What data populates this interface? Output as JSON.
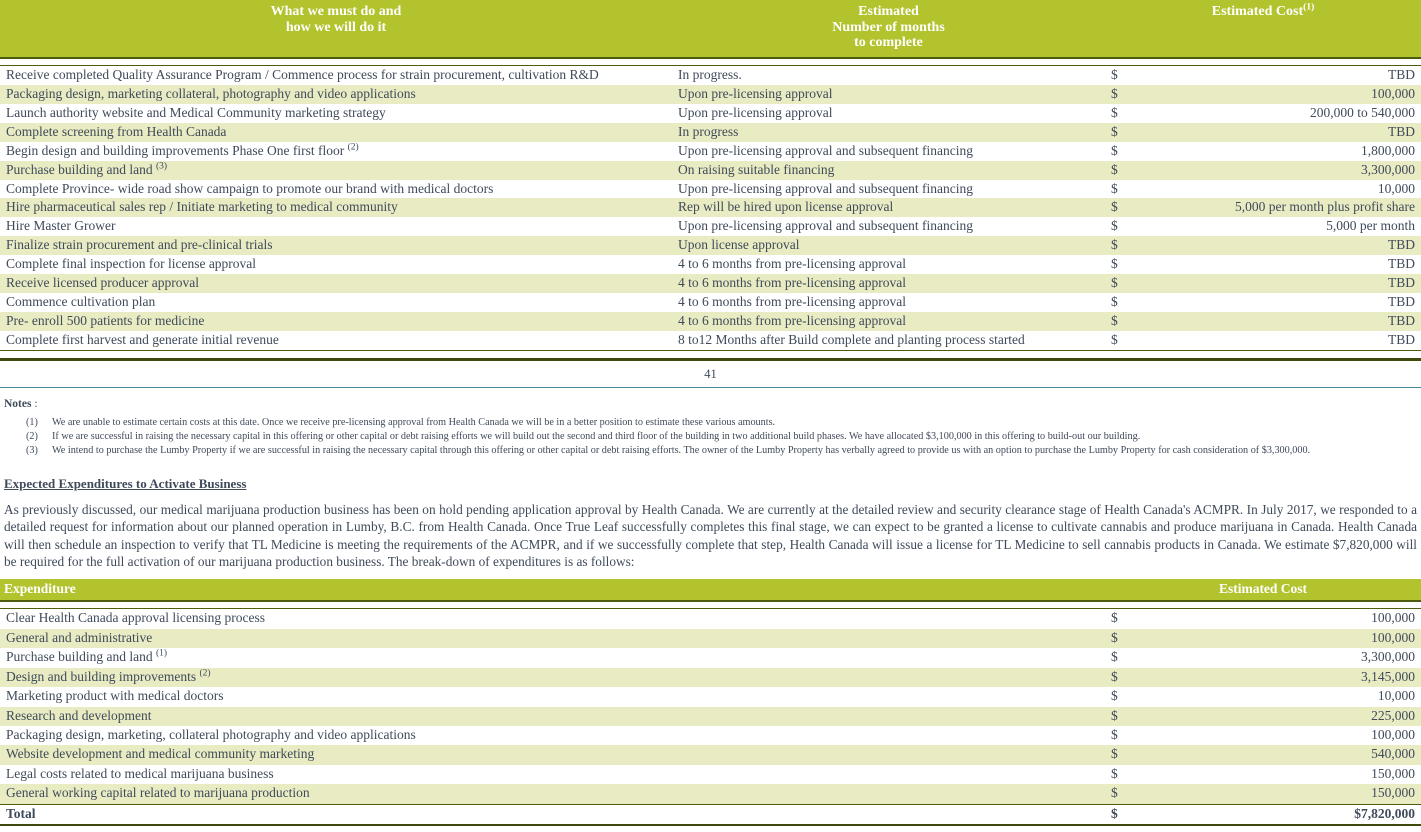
{
  "milestones_table": {
    "headers": {
      "task": "What we must do and\nhow we will do it",
      "task_line1": "What we must do and",
      "task_line2": "how we will do it",
      "months_line1": "Estimated",
      "months_line2": "Number of months",
      "months_line3": "to complete",
      "cost": "Estimated Cost",
      "cost_footnote": "(1)"
    },
    "rows": [
      {
        "task": "Receive completed Quality Assurance Program / Commence process for strain procurement, cultivation R&D",
        "task_sup": "",
        "when": "In progress.",
        "dollar": "$",
        "cost": "TBD"
      },
      {
        "task": "Packaging design, marketing collateral, photography and video applications",
        "task_sup": "",
        "when": "Upon pre-licensing approval",
        "dollar": "$",
        "cost": "100,000"
      },
      {
        "task": "Launch authority website and Medical Community marketing strategy",
        "task_sup": "",
        "when": "Upon pre-licensing approval",
        "dollar": "$",
        "cost": "200,000 to 540,000"
      },
      {
        "task": "Complete screening from Health Canada",
        "task_sup": "",
        "when": "In progress",
        "dollar": "$",
        "cost": "TBD"
      },
      {
        "task": "Begin design and building improvements Phase One first floor",
        "task_sup": "(2)",
        "when": "Upon pre-licensing approval and subsequent financing",
        "dollar": "$",
        "cost": "1,800,000"
      },
      {
        "task": "Purchase building and land",
        "task_sup": "(3)",
        "when": "On raising suitable financing",
        "dollar": "$",
        "cost": "3,300,000"
      },
      {
        "task": "Complete Province- wide road show campaign to promote our brand with medical doctors",
        "task_sup": "",
        "when": "Upon pre-licensing approval and subsequent financing",
        "dollar": "$",
        "cost": "10,000"
      },
      {
        "task": "Hire pharmaceutical sales rep / Initiate marketing to medical community",
        "task_sup": "",
        "when": "Rep will be hired upon license approval",
        "dollar": "$",
        "cost": "5,000 per month plus profit share"
      },
      {
        "task": "Hire Master Grower",
        "task_sup": "",
        "when": "Upon pre-licensing approval and subsequent financing",
        "dollar": "$",
        "cost": "5,000 per month"
      },
      {
        "task": "Finalize strain procurement and pre-clinical trials",
        "task_sup": "",
        "when": "Upon license approval",
        "dollar": "$",
        "cost": "TBD"
      },
      {
        "task": "Complete final inspection for license approval",
        "task_sup": "",
        "when": "4 to 6 months from pre-licensing approval",
        "dollar": "$",
        "cost": "TBD"
      },
      {
        "task": "Receive licensed producer approval",
        "task_sup": "",
        "when": "4 to 6 months from pre-licensing approval",
        "dollar": "$",
        "cost": "TBD"
      },
      {
        "task": "Commence cultivation plan",
        "task_sup": "",
        "when": "4 to 6 months from pre-licensing approval",
        "dollar": "$",
        "cost": "TBD"
      },
      {
        "task": "Pre- enroll 500 patients for medicine",
        "task_sup": "",
        "when": "4 to 6 months from pre-licensing approval",
        "dollar": "$",
        "cost": "TBD"
      },
      {
        "task": "Complete first harvest and generate initial revenue",
        "task_sup": "",
        "when": "8 to12 Months after Build complete and planting process started",
        "dollar": "$",
        "cost": "TBD"
      }
    ]
  },
  "page_number": "41",
  "notes": {
    "title": "Notes",
    "title_colon": " :",
    "items": [
      {
        "marker": "(1)",
        "text": "We are unable to estimate certain costs at this date. Once we receive pre-licensing approval from Health Canada we will be in a better position to estimate these various amounts."
      },
      {
        "marker": "(2)",
        "text": "If we are successful in raising the necessary capital in this offering or other capital or debt raising efforts we will build out the second and third floor of the building in two additional build phases. We have allocated $3,100,000 in this offering to build-out our building."
      },
      {
        "marker": "(3)",
        "text": "We intend to purchase the Lumby Property if we are successful in raising the necessary capital through this offering or other capital or debt raising efforts. The owner of the Lumby Property has verbally agreed to provide us with an option to purchase the Lumby Property for cash consideration of $3,300,000."
      }
    ]
  },
  "section": {
    "heading": "Expected Expenditures to Activate Business",
    "paragraph": "As previously discussed, our medical marijuana production business has been on hold pending application approval by Health Canada. We are currently at the detailed review and security clearance stage of Health Canada's ACMPR. In July 2017, we responded to a detailed request for information about our planned operation in Lumby, B.C. from Health Canada. Once True Leaf successfully completes this final stage, we can expect to be granted a license to cultivate cannabis and produce marijuana in Canada. Health Canada will then schedule an inspection to verify that TL Medicine is meeting the requirements of the ACMPR, and if we successfully complete that step, Health Canada will issue a license for TL Medicine to sell cannabis products in Canada. We estimate $7,820,000 will be required for the full activation of our marijuana production business. The break-down of expenditures is as follows:"
  },
  "expenditure_table": {
    "headers": {
      "expenditure": "Expenditure",
      "cost": "Estimated Cost"
    },
    "rows": [
      {
        "name": "Clear Health Canada approval licensing process",
        "name_sup": "",
        "dollar": "$",
        "cost": "100,000"
      },
      {
        "name": "General and administrative",
        "name_sup": "",
        "dollar": "$",
        "cost": "100,000"
      },
      {
        "name": "Purchase building and land",
        "name_sup": "(1)",
        "dollar": "$",
        "cost": "3,300,000"
      },
      {
        "name": "Design and building improvements",
        "name_sup": "(2)",
        "dollar": "$",
        "cost": "3,145,000"
      },
      {
        "name": "Marketing product with medical doctors",
        "name_sup": "",
        "dollar": "$",
        "cost": "10,000"
      },
      {
        "name": "Research and development",
        "name_sup": "",
        "dollar": "$",
        "cost": "225,000"
      },
      {
        "name": "Packaging design, marketing, collateral photography and video applications",
        "name_sup": "",
        "dollar": "$",
        "cost": "100,000"
      },
      {
        "name": "Website development and medical community marketing",
        "name_sup": "",
        "dollar": "$",
        "cost": "540,000"
      },
      {
        "name": "Legal costs related to medical marijuana business",
        "name_sup": "",
        "dollar": "$",
        "cost": "150,000"
      },
      {
        "name": "General working capital related to marijuana production",
        "name_sup": "",
        "dollar": "$",
        "cost": "150,000"
      }
    ],
    "total": {
      "name": "Total",
      "dollar": "$",
      "cost": "$7,820,000"
    }
  },
  "colors": {
    "header_green": "#b3c32e",
    "row_stripe": "#e9ecc3",
    "rule_dark": "#3d4a0c",
    "text": "#3f4a5a",
    "page_rule": "#3f8a96"
  }
}
